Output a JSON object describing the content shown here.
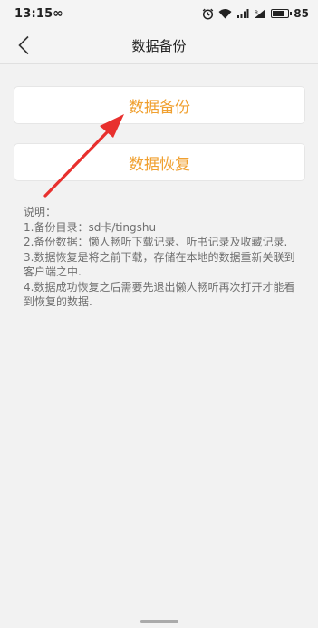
{
  "status_bar": {
    "time": "13:15",
    "infinity_glyph": "∞",
    "icons": [
      "alarm-icon",
      "wifi-icon",
      "signal-icon",
      "sim-signal-icon",
      "battery-icon"
    ],
    "battery_level": "85",
    "battery_fraction": 0.85
  },
  "header": {
    "title": "数据备份"
  },
  "buttons": {
    "backup_label": "数据备份",
    "restore_label": "数据恢复",
    "accent_color": "#f0a030"
  },
  "description": {
    "lines": [
      "说明：",
      "1.备份目录：sd卡/tingshu",
      "2.备份数据：懒人畅听下载记录、听书记录及收藏记录.",
      "3.数据恢复是将之前下载，存储在本地的数据重新关联到客户端之中.",
      "4.数据成功恢复之后需要先退出懒人畅听再次打开才能看到恢复的数据."
    ]
  },
  "annotation": {
    "arrow_color": "#e8302e"
  }
}
